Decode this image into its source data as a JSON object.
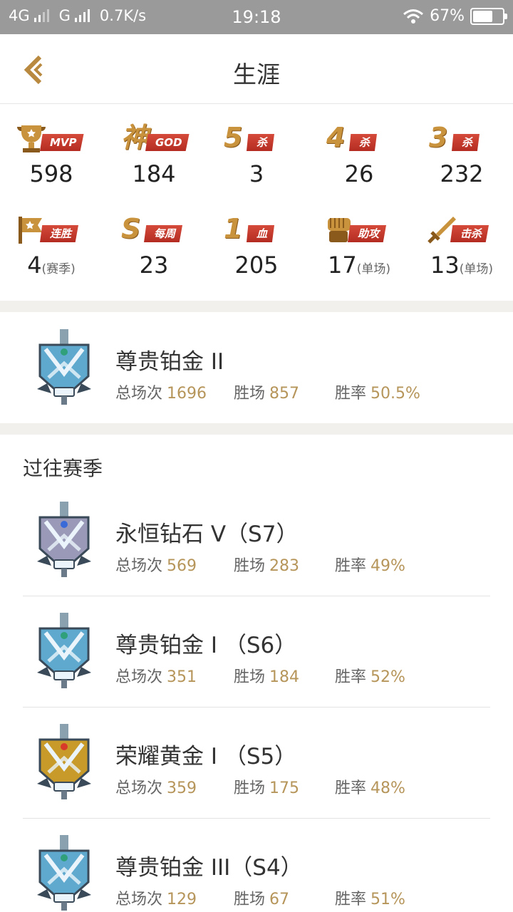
{
  "status_bar": {
    "net1": "4G",
    "net2": "G",
    "speed": "0.7K/s",
    "time": "19:18",
    "battery": "67%",
    "battery_level": 0.67
  },
  "header": {
    "title": "生涯"
  },
  "stats": [
    {
      "label": "MVP",
      "emblem": "trophy-icon",
      "emblem_text": "",
      "value": "598",
      "suffix": ""
    },
    {
      "label": "GOD",
      "emblem": "god-icon",
      "emblem_text": "神",
      "value": "184",
      "suffix": ""
    },
    {
      "label": "杀",
      "emblem": "five-kill-icon",
      "emblem_text": "5",
      "value": "3",
      "suffix": ""
    },
    {
      "label": "杀",
      "emblem": "four-kill-icon",
      "emblem_text": "4",
      "value": "26",
      "suffix": ""
    },
    {
      "label": "杀",
      "emblem": "three-kill-icon",
      "emblem_text": "3",
      "value": "232",
      "suffix": ""
    },
    {
      "label": "连胜",
      "emblem": "flag-icon",
      "emblem_text": "",
      "value": "4",
      "suffix": "(赛季)"
    },
    {
      "label": "每周",
      "emblem": "weekly-s-icon",
      "emblem_text": "S",
      "value": "23",
      "suffix": ""
    },
    {
      "label": "血",
      "emblem": "first-blood-icon",
      "emblem_text": "1",
      "value": "205",
      "suffix": ""
    },
    {
      "label": "助攻",
      "emblem": "fist-icon",
      "emblem_text": "",
      "value": "17",
      "suffix": "(单场)"
    },
    {
      "label": "击杀",
      "emblem": "sword-icon",
      "emblem_text": "",
      "value": "13",
      "suffix": "(单场)"
    }
  ],
  "labels": {
    "total": "总场次",
    "wins": "胜场",
    "rate": "胜率",
    "past_seasons": "过往赛季"
  },
  "current_rank": {
    "name": "尊贵铂金 II",
    "tier": "platinum",
    "total": "1696",
    "wins": "857",
    "rate": "50.5%"
  },
  "past_seasons": [
    {
      "name": "永恒钻石 V（S7）",
      "tier": "diamond",
      "total": "569",
      "wins": "283",
      "rate": "49%"
    },
    {
      "name": "尊贵铂金 I （S6）",
      "tier": "platinum",
      "total": "351",
      "wins": "184",
      "rate": "52%"
    },
    {
      "name": "荣耀黄金 I （S5）",
      "tier": "gold",
      "total": "359",
      "wins": "175",
      "rate": "48%"
    },
    {
      "name": "尊贵铂金 III（S4）",
      "tier": "platinum",
      "total": "129",
      "wins": "67",
      "rate": "51%"
    }
  ],
  "colors": {
    "accent_gold": "#b6955a",
    "ribbon_red": "#c23a2c",
    "platinum": "#5fa9cf",
    "diamond": "#9a9ab8",
    "gold": "#c89a2a"
  }
}
